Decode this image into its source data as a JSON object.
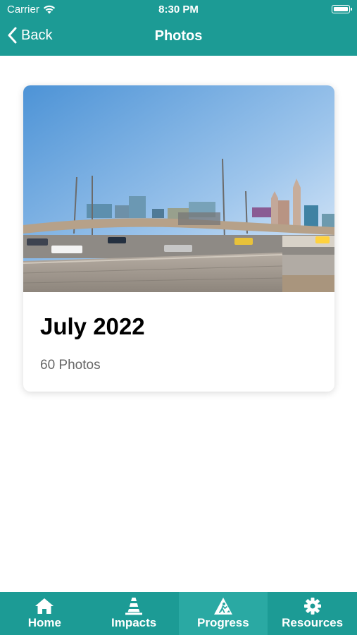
{
  "status_bar": {
    "carrier": "Carrier",
    "time": "8:30 PM"
  },
  "nav": {
    "back_label": "Back",
    "title": "Photos"
  },
  "albums": [
    {
      "title": "July 2022",
      "count": "60 Photos"
    }
  ],
  "tabs": [
    {
      "label": "Home",
      "icon": "home-icon"
    },
    {
      "label": "Impacts",
      "icon": "traffic-cone-icon"
    },
    {
      "label": "Progress",
      "icon": "construction-sign-icon",
      "active": true
    },
    {
      "label": "Resources",
      "icon": "gear-icon"
    }
  ],
  "colors": {
    "primary": "#1c9b95",
    "active_tab": "#2aa9a3"
  }
}
